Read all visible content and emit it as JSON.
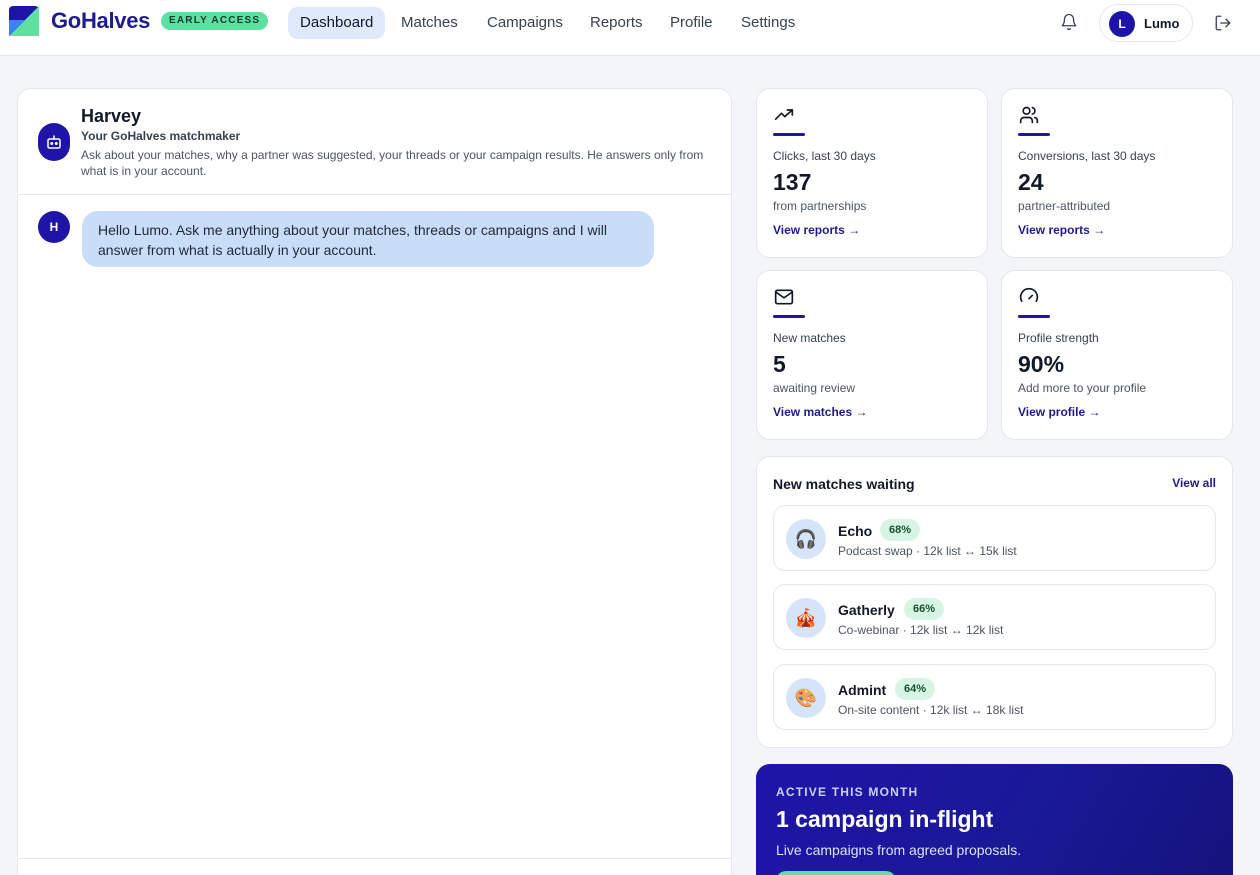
{
  "brand": {
    "name": "GoHalves",
    "badge": "EARLY ACCESS"
  },
  "nav": {
    "items": [
      {
        "label": "Dashboard",
        "active": true
      },
      {
        "label": "Matches"
      },
      {
        "label": "Campaigns"
      },
      {
        "label": "Reports"
      },
      {
        "label": "Profile"
      },
      {
        "label": "Settings"
      }
    ]
  },
  "user": {
    "initial": "L",
    "name": "Lumo"
  },
  "chat": {
    "title": "Harvey",
    "subtitle": "Your GoHalves matchmaker",
    "description": "Ask about your matches, why a partner was suggested, your threads or your campaign results. He answers only from what is in your account.",
    "messages": [
      {
        "avatar": "H",
        "text": "Hello Lumo. Ask me anything about your matches, threads or campaigns and I will answer from what is actually in your account."
      }
    ]
  },
  "stats": [
    {
      "icon": "trending-up-icon",
      "label": "Clicks, last 30 days",
      "value": "137",
      "sub": "from partnerships",
      "link": "View reports →"
    },
    {
      "icon": "users-icon",
      "label": "Conversions, last 30 days",
      "value": "24",
      "sub": "partner-attributed",
      "link": "View reports →"
    },
    {
      "icon": "mail-icon",
      "label": "New matches",
      "value": "5",
      "sub": "awaiting review",
      "link": "View matches →"
    },
    {
      "icon": "gauge-icon",
      "label": "Profile strength",
      "value": "90%",
      "sub": "Add more to your profile",
      "link": "View profile →"
    }
  ],
  "matches": {
    "title": "New matches waiting",
    "view_all": "View all",
    "items": [
      {
        "name": "Echo",
        "score": "68%",
        "detail": "Podcast swap · 12k list ↔ 15k list",
        "emoji": "🎧"
      },
      {
        "name": "Gatherly",
        "score": "66%",
        "detail": "Co-webinar · 12k list ↔ 12k list",
        "emoji": "🎪"
      },
      {
        "name": "Admint",
        "score": "64%",
        "detail": "On-site content · 12k list ↔ 18k list",
        "emoji": "🎨"
      }
    ]
  },
  "active": {
    "kicker": "ACTIVE THIS MONTH",
    "title": "1 campaign in-flight",
    "description": "Live campaigns from agreed proposals."
  },
  "colors": {
    "brand": "#1e1b8f",
    "accent": "#1e14a8",
    "badge": "#5ee0a1",
    "bubble": "#c9dcf8"
  }
}
